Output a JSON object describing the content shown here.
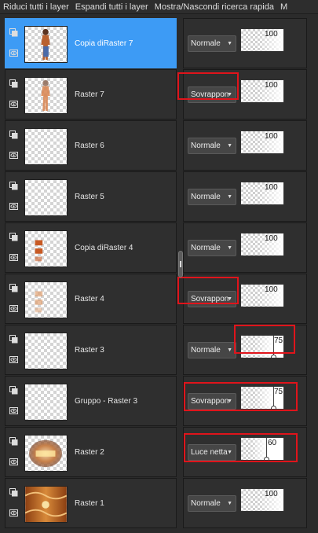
{
  "toolbar": {
    "collapse_all": "Riduci tutti i layer",
    "expand_all": "Espandi tutti i layer",
    "toggle_search": "Mostra/Nascondi ricerca rapida",
    "more": "M"
  },
  "layers": [
    {
      "name": "Copia diRaster 7",
      "blend": "Normale",
      "opacity": 100,
      "selected": true,
      "thumb": "woman-icon"
    },
    {
      "name": "Raster 7",
      "blend": "Sovrappon",
      "opacity": 100,
      "selected": false,
      "thumb": "woman-faded-icon",
      "highlighted": [
        "blend"
      ]
    },
    {
      "name": "Raster 6",
      "blend": "Normale",
      "opacity": 100,
      "selected": false,
      "thumb": "empty"
    },
    {
      "name": "Raster 5",
      "blend": "Normale",
      "opacity": 100,
      "selected": false,
      "thumb": "empty"
    },
    {
      "name": "Copia diRaster 4",
      "blend": "Normale",
      "opacity": 100,
      "selected": false,
      "thumb": "boxes-icon"
    },
    {
      "name": "Raster 4",
      "blend": "Sovrappon",
      "opacity": 100,
      "selected": false,
      "thumb": "boxes-faded-icon",
      "highlighted": [
        "blend"
      ]
    },
    {
      "name": "Raster 3",
      "blend": "Normale",
      "opacity": 75,
      "selected": false,
      "thumb": "empty",
      "highlighted": [
        "opacity"
      ]
    },
    {
      "name": "Gruppo - Raster 3",
      "blend": "Sovrappon",
      "opacity": 75,
      "selected": false,
      "thumb": "empty",
      "highlighted": [
        "blend-opacity"
      ]
    },
    {
      "name": "Raster 2",
      "blend": "Luce netta",
      "opacity": 60,
      "selected": false,
      "thumb": "ornament-icon",
      "highlighted": [
        "blend-opacity"
      ]
    },
    {
      "name": "Raster 1",
      "blend": "Normale",
      "opacity": 100,
      "selected": false,
      "thumb": "pattern-icon"
    }
  ],
  "colors": {
    "selected": "#3d9bf5",
    "panel": "#2f2f2f",
    "highlight": "#e0141b"
  }
}
